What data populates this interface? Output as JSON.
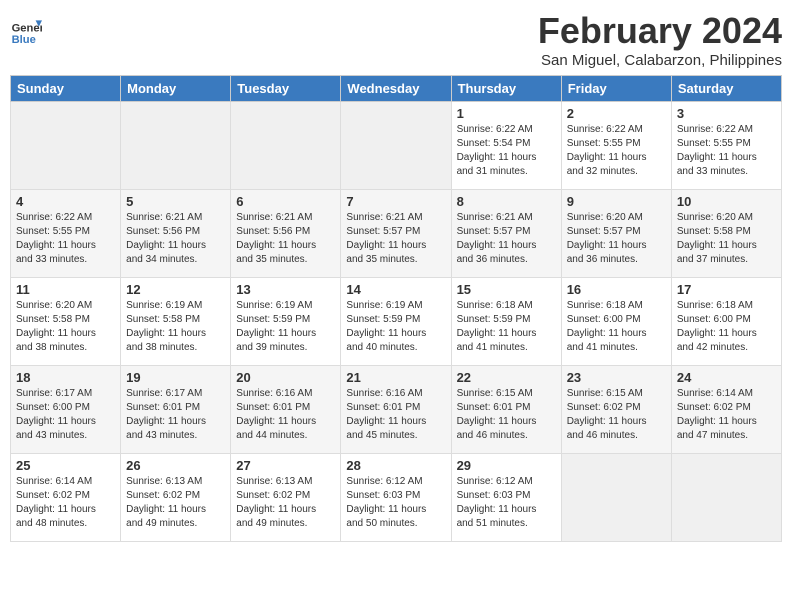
{
  "header": {
    "logo_line1": "General",
    "logo_line2": "Blue",
    "title": "February 2024",
    "subtitle": "San Miguel, Calabarzon, Philippines"
  },
  "days_of_week": [
    "Sunday",
    "Monday",
    "Tuesday",
    "Wednesday",
    "Thursday",
    "Friday",
    "Saturday"
  ],
  "weeks": [
    [
      {
        "day": "",
        "empty": true
      },
      {
        "day": "",
        "empty": true
      },
      {
        "day": "",
        "empty": true
      },
      {
        "day": "",
        "empty": true
      },
      {
        "day": "1",
        "sunrise": "6:22 AM",
        "sunset": "5:54 PM",
        "daylight": "11 hours and 31 minutes."
      },
      {
        "day": "2",
        "sunrise": "6:22 AM",
        "sunset": "5:55 PM",
        "daylight": "11 hours and 32 minutes."
      },
      {
        "day": "3",
        "sunrise": "6:22 AM",
        "sunset": "5:55 PM",
        "daylight": "11 hours and 33 minutes."
      }
    ],
    [
      {
        "day": "4",
        "sunrise": "6:22 AM",
        "sunset": "5:55 PM",
        "daylight": "11 hours and 33 minutes."
      },
      {
        "day": "5",
        "sunrise": "6:21 AM",
        "sunset": "5:56 PM",
        "daylight": "11 hours and 34 minutes."
      },
      {
        "day": "6",
        "sunrise": "6:21 AM",
        "sunset": "5:56 PM",
        "daylight": "11 hours and 35 minutes."
      },
      {
        "day": "7",
        "sunrise": "6:21 AM",
        "sunset": "5:57 PM",
        "daylight": "11 hours and 35 minutes."
      },
      {
        "day": "8",
        "sunrise": "6:21 AM",
        "sunset": "5:57 PM",
        "daylight": "11 hours and 36 minutes."
      },
      {
        "day": "9",
        "sunrise": "6:20 AM",
        "sunset": "5:57 PM",
        "daylight": "11 hours and 36 minutes."
      },
      {
        "day": "10",
        "sunrise": "6:20 AM",
        "sunset": "5:58 PM",
        "daylight": "11 hours and 37 minutes."
      }
    ],
    [
      {
        "day": "11",
        "sunrise": "6:20 AM",
        "sunset": "5:58 PM",
        "daylight": "11 hours and 38 minutes."
      },
      {
        "day": "12",
        "sunrise": "6:19 AM",
        "sunset": "5:58 PM",
        "daylight": "11 hours and 38 minutes."
      },
      {
        "day": "13",
        "sunrise": "6:19 AM",
        "sunset": "5:59 PM",
        "daylight": "11 hours and 39 minutes."
      },
      {
        "day": "14",
        "sunrise": "6:19 AM",
        "sunset": "5:59 PM",
        "daylight": "11 hours and 40 minutes."
      },
      {
        "day": "15",
        "sunrise": "6:18 AM",
        "sunset": "5:59 PM",
        "daylight": "11 hours and 41 minutes."
      },
      {
        "day": "16",
        "sunrise": "6:18 AM",
        "sunset": "6:00 PM",
        "daylight": "11 hours and 41 minutes."
      },
      {
        "day": "17",
        "sunrise": "6:18 AM",
        "sunset": "6:00 PM",
        "daylight": "11 hours and 42 minutes."
      }
    ],
    [
      {
        "day": "18",
        "sunrise": "6:17 AM",
        "sunset": "6:00 PM",
        "daylight": "11 hours and 43 minutes."
      },
      {
        "day": "19",
        "sunrise": "6:17 AM",
        "sunset": "6:01 PM",
        "daylight": "11 hours and 43 minutes."
      },
      {
        "day": "20",
        "sunrise": "6:16 AM",
        "sunset": "6:01 PM",
        "daylight": "11 hours and 44 minutes."
      },
      {
        "day": "21",
        "sunrise": "6:16 AM",
        "sunset": "6:01 PM",
        "daylight": "11 hours and 45 minutes."
      },
      {
        "day": "22",
        "sunrise": "6:15 AM",
        "sunset": "6:01 PM",
        "daylight": "11 hours and 46 minutes."
      },
      {
        "day": "23",
        "sunrise": "6:15 AM",
        "sunset": "6:02 PM",
        "daylight": "11 hours and 46 minutes."
      },
      {
        "day": "24",
        "sunrise": "6:14 AM",
        "sunset": "6:02 PM",
        "daylight": "11 hours and 47 minutes."
      }
    ],
    [
      {
        "day": "25",
        "sunrise": "6:14 AM",
        "sunset": "6:02 PM",
        "daylight": "11 hours and 48 minutes."
      },
      {
        "day": "26",
        "sunrise": "6:13 AM",
        "sunset": "6:02 PM",
        "daylight": "11 hours and 49 minutes."
      },
      {
        "day": "27",
        "sunrise": "6:13 AM",
        "sunset": "6:02 PM",
        "daylight": "11 hours and 49 minutes."
      },
      {
        "day": "28",
        "sunrise": "6:12 AM",
        "sunset": "6:03 PM",
        "daylight": "11 hours and 50 minutes."
      },
      {
        "day": "29",
        "sunrise": "6:12 AM",
        "sunset": "6:03 PM",
        "daylight": "11 hours and 51 minutes."
      },
      {
        "day": "",
        "empty": true
      },
      {
        "day": "",
        "empty": true
      }
    ]
  ]
}
